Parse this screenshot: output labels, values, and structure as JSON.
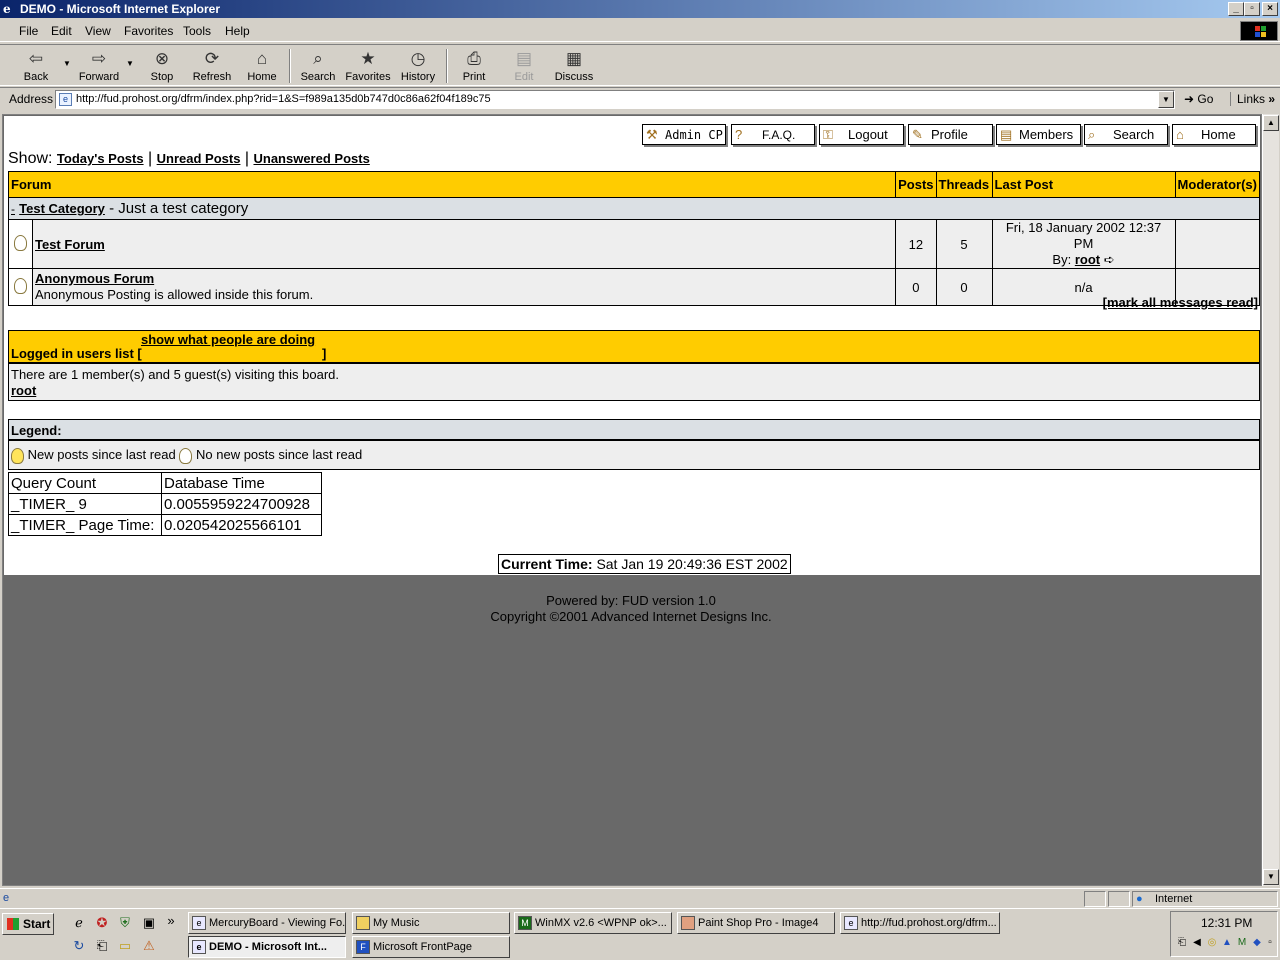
{
  "window": {
    "title": "DEMO - Microsoft Internet Explorer",
    "controls": {
      "minimize": "_",
      "maximize": "▫",
      "close": "×"
    }
  },
  "menu": [
    "File",
    "Edit",
    "View",
    "Favorites",
    "Tools",
    "Help"
  ],
  "toolbar": {
    "back": "Back",
    "forward": "Forward",
    "stop": "Stop",
    "refresh": "Refresh",
    "home": "Home",
    "search": "Search",
    "favorites": "Favorites",
    "history": "History",
    "print": "Print",
    "edit": "Edit",
    "discuss": "Discuss"
  },
  "address": {
    "label": "Address",
    "url": "http://fud.prohost.org/dfrm/index.php?rid=1&S=f989a135d0b747d0c86a62f04f189c75",
    "go": "Go",
    "links": "Links"
  },
  "page": {
    "nav": [
      "Admin CP",
      "F.A.Q.",
      "Logout",
      "Profile",
      "Members",
      "Search",
      "Home"
    ],
    "show_label": "Show:",
    "show_links": [
      "Today's Posts",
      "Unread Posts",
      "Unanswered Posts"
    ],
    "table_headers": {
      "forum": "Forum",
      "posts": "Posts",
      "threads": "Threads",
      "last_post": "Last Post",
      "moderators": "Moderator(s)"
    },
    "category": {
      "toggle": "-",
      "name": "Test Category",
      "desc": " - Just a test category"
    },
    "forums": [
      {
        "name": "Test Forum",
        "desc": "",
        "posts": "12",
        "threads": "5",
        "last_post_date": "Fri, 18 January 2002 12:37 PM",
        "last_post_by_label": "By:",
        "last_post_by": "root",
        "moderators": ""
      },
      {
        "name": "Anonymous Forum",
        "desc": "Anonymous Posting is allowed inside this forum.",
        "posts": "0",
        "threads": "0",
        "last_post_date": "n/a",
        "moderators": ""
      }
    ],
    "mark_all": "[mark all messages read]",
    "logged_in": {
      "title": "Logged in users list [",
      "link": "show what people are doing",
      "close": "]",
      "summary": "There are 1 member(s) and 5 guest(s) visiting this board.",
      "user": "root"
    },
    "legend": {
      "title": "Legend:",
      "new": "New posts since last read",
      "none": "No new posts since last read"
    },
    "timers": [
      [
        "Query Count",
        "Database Time"
      ],
      [
        "_TIMER_ 9",
        "0.0055959224700928"
      ],
      [
        "_TIMER_ Page Time:",
        "0.020542025566101"
      ]
    ],
    "current_time_label": "Current Time:",
    "current_time": "Sat Jan 19 20:49:36 EST 2002",
    "footer_line1": "Powered by: FUD version 1.0",
    "footer_line2": "Copyright ©2001 Advanced Internet Designs Inc."
  },
  "statusbar": {
    "zone": "Internet"
  },
  "taskbar": {
    "start": "Start",
    "tasks_row1": [
      "MercuryBoard - Viewing Fo...",
      "My Music",
      "WinMX v2.6  <WPNP ok>...",
      "Paint Shop Pro - Image4",
      "http://fud.prohost.org/dfrm..."
    ],
    "tasks_row2": [
      "DEMO - Microsoft Int...",
      "Microsoft FrontPage"
    ],
    "clock": "12:31 PM"
  }
}
